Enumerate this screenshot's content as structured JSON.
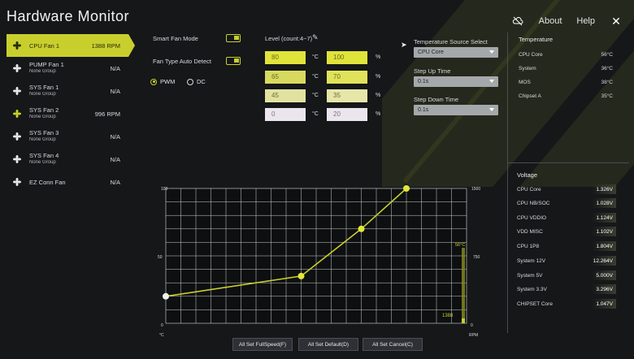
{
  "app": {
    "title": "Hardware Monitor"
  },
  "top_bar": {
    "about": "About",
    "help": "Help"
  },
  "colors": {
    "accent": "#c8cf2d",
    "bg": "#151719"
  },
  "fans": [
    {
      "name": "CPU Fan 1",
      "sub": "",
      "value": "1388 RPM",
      "active": true,
      "icon": "fan-icon"
    },
    {
      "name": "PUMP Fan 1",
      "sub": "None Group",
      "value": "N/A",
      "active": false,
      "icon": "fan-icon"
    },
    {
      "name": "SYS Fan 1",
      "sub": "None Group",
      "value": "N/A",
      "active": false,
      "icon": "fan-icon"
    },
    {
      "name": "SYS Fan 2",
      "sub": "None Group",
      "value": "996 RPM",
      "active": false,
      "icon": "fan-icon"
    },
    {
      "name": "SYS Fan 3",
      "sub": "None Group",
      "value": "N/A",
      "active": false,
      "icon": "fan-icon"
    },
    {
      "name": "SYS Fan 4",
      "sub": "None Group",
      "value": "N/A",
      "active": false,
      "icon": "fan-icon"
    },
    {
      "name": "EZ Conn Fan",
      "sub": "",
      "value": "N/A",
      "active": false,
      "icon": "fan-icon"
    }
  ],
  "controls": {
    "smart_fan_mode": "Smart Fan Mode",
    "fan_type_auto_detect": "Fan Type Auto Detect",
    "pwm": "PWM",
    "dc": "DC",
    "level_label": "Level (count:4~7)",
    "levels": [
      {
        "temp": "80",
        "temp_unit": "°C",
        "pct": "100",
        "pct_unit": "%"
      },
      {
        "temp": "65",
        "temp_unit": "°C",
        "pct": "70",
        "pct_unit": "%"
      },
      {
        "temp": "45",
        "temp_unit": "°C",
        "pct": "35",
        "pct_unit": "%"
      },
      {
        "temp": "0",
        "temp_unit": "°C",
        "pct": "20",
        "pct_unit": "%"
      }
    ],
    "temp_source_label": "Temperature Source Select",
    "temp_source_value": "CPU Core",
    "step_up_label": "Step Up Time",
    "step_up_value": "0.1s",
    "step_down_label": "Step Down Time",
    "step_down_value": "0.1s"
  },
  "temperature": {
    "title": "Temperature",
    "rows": [
      {
        "label": "CPU Core",
        "value": "56°C"
      },
      {
        "label": "System",
        "value": "36°C"
      },
      {
        "label": "MOS",
        "value": "38°C"
      },
      {
        "label": "Chipset A",
        "value": "35°C"
      }
    ]
  },
  "voltage": {
    "title": "Voltage",
    "rows": [
      {
        "label": "CPU Core",
        "value": "1.326V"
      },
      {
        "label": "CPU NB/SOC",
        "value": "1.028V"
      },
      {
        "label": "CPU VDDIO",
        "value": "1.124V"
      },
      {
        "label": "VDD MISC",
        "value": "1.102V"
      },
      {
        "label": "CPU 1P8",
        "value": "1.804V"
      },
      {
        "label": "System 12V",
        "value": "12.264V"
      },
      {
        "label": "System 5V",
        "value": "5.000V"
      },
      {
        "label": "System 3.3V",
        "value": "3.296V"
      },
      {
        "label": "CHIPSET Core",
        "value": "1.047V"
      }
    ]
  },
  "chart_data": {
    "type": "line",
    "x_unit": "°C",
    "y_unit": "RPM",
    "left_axis_ticks": [
      "100",
      "50",
      "0"
    ],
    "right_axis_ticks": [
      "1500",
      "750",
      "0"
    ],
    "points": [
      {
        "x": 0,
        "y": 20
      },
      {
        "x": 45,
        "y": 35
      },
      {
        "x": 65,
        "y": 70
      },
      {
        "x": 80,
        "y": 100
      }
    ],
    "xlim": [
      0,
      100
    ],
    "ylim": [
      0,
      100
    ],
    "current_temp_label": "56°C",
    "current_temp": 56,
    "current_rpm_label": "1388",
    "current_rpm": 1388,
    "rpm_max": 1500,
    "grid": true
  },
  "buttons": {
    "full_speed": "All Set FullSpeed(F)",
    "default": "All Set Default(D)",
    "cancel": "All Set Cancel(C)"
  }
}
